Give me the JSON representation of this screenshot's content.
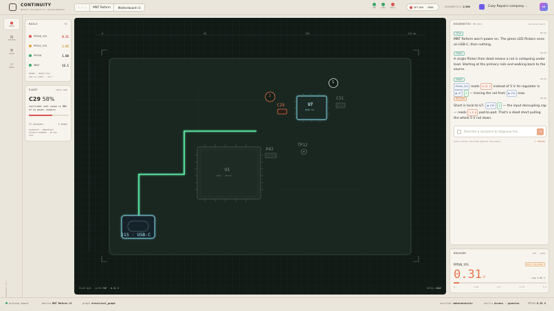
{
  "app": {
    "name": "CONTINUITY",
    "tagline": "BENCH DIAGNOSTIC ENVIRONMENT"
  },
  "toolbar": {
    "nav_arrows": "‹ › ⌄",
    "device": "MNT Reform",
    "board": "Motherboard r3"
  },
  "status": {
    "items": [
      {
        "label": "PWR",
        "color": "#3aa66a"
      },
      {
        "label": "LINK",
        "color": "#3aa66a"
      },
      {
        "label": "FAULT",
        "color": "#d9534f"
      }
    ],
    "session": "SPT-055 · GROG",
    "diag_label": "DIAGNOSTICS",
    "diag_count": "1/300",
    "workspace": "Cozy Repairs company",
    "avatar": "CR"
  },
  "sidebar": {
    "items": [
      {
        "label": "BENCH",
        "active": true
      },
      {
        "label": "SESSION"
      },
      {
        "label": "GRAPH"
      },
      {
        "label": "PARTS"
      }
    ],
    "version": "CONTINUITY V0.3"
  },
  "rails": {
    "title": "RAILS",
    "count": "05",
    "items": [
      {
        "name": "PP5V0_SYS",
        "value": "0.31",
        "color": "#d9534f",
        "value_color": "#c0392b"
      },
      {
        "name": "PP3V3_SYS",
        "value": "2.95",
        "color": "#e3a23c",
        "value_color": "#c98a24"
      },
      {
        "name": "PP5VB",
        "value": "1.80",
        "color": "#3aa66a",
        "value_color": "#2e2a24"
      },
      {
        "name": "VBAT",
        "value": "12.1",
        "color": "#3aa66a",
        "value_color": "#2e2a24"
      }
    ],
    "footer1": "PROBE · BENCH PSU",
    "footer2": "500 ms LIMIT · 25°C"
  },
  "fleet": {
    "title": "FLEET",
    "tag": "CROSS-SHOP",
    "headline_ref": "C29",
    "headline_pct": "58%",
    "desc1": "confirmed root cause in",
    "desc_bold": "58%",
    "desc2": "of no power repairs",
    "progress": 0.58,
    "stats_left": "12 sessions",
    "stats_right": "5 shops",
    "notes": [
      "AGGREGATE · ANONYMIZED",
      "SECURITY BOUNDED · NO RAW",
      "LOGS"
    ]
  },
  "board": {
    "ruler_top": [
      "0",
      "50",
      "100",
      "120 mm"
    ],
    "labels": {
      "u7": "U7",
      "u7sub": "BUCK 5V",
      "c29": "C29",
      "c31": "C31",
      "r42": "R42",
      "tp12": "TP12",
      "u1": "U1",
      "u1sub": "PMIC · BD718",
      "j15": "J15 · USB-C"
    },
    "markers": [
      "1",
      "2"
    ],
    "footer_left_label": "PLACE",
    "footer_left_val": "4/1",
    "footer_mid_label": "LAYER",
    "footer_mid_val": "TOP",
    "footer_mid2": "0.31 V",
    "footer_right_label": "DETAIL",
    "footer_right_val": "EDGE"
  },
  "diagnostic": {
    "title": "DIAGNOSTIC",
    "sub": "MR-2241",
    "status": "· pulsing board",
    "entries": [
      {
        "tag": "TECH",
        "time": "09:32",
        "text": "MNT Reform won't power on. The green LED flickers once on USB-C, then nothing."
      },
      {
        "tag": "TRACE",
        "time": "09:33",
        "text": "A single flicker then dead means a rail is collapsing under load. Starting at the primary rails and walking back to the source."
      },
      {
        "tag": "TRACE",
        "time": "09:33",
        "pre": "PP5V0_SYS",
        "mid": "reads",
        "val": "0.31 V",
        "post": "instead of 5 V. Its regulator is",
        "c1": "U7",
        "n1": "1",
        "post2": "— tracing the rail from",
        "c2": "J15",
        "post3": "now."
      },
      {
        "tag": "MEASURE",
        "time": "09:34",
        "p1": "Short is local to U7.",
        "c1": "C29",
        "n2": "2",
        "p2": "— the input decoupling cap — reads",
        "val": "3.9 Ω",
        "p3": "pad-to-pad. That's a dead short pulling the whole 5 V rail down."
      }
    ],
    "input_placeholder": "Describe a symptom to diagnose live...",
    "footer": "every action verified against the board",
    "footer_right": "replay"
  },
  "measure": {
    "title": "MEASURE",
    "tag": "DCV · AUTO",
    "net": "PP5V0_SYS",
    "badge": "RAIL COLLAPSE",
    "value": "0.31",
    "unit": "V",
    "exp": "exp 5.00 V",
    "scale": [
      "0",
      "1.25",
      "2.5",
      "3.75",
      "5 V"
    ],
    "fill": 0.062
  },
  "bottom": {
    "status": "pulsing board",
    "device_label": "device",
    "device": "MNT Reform r3",
    "graph_label": "graph",
    "graph": "electrical_graph",
    "verifier": "verifier",
    "verifier_val": "deterministic",
    "skills_label": "skills",
    "skills": "Access · pyvector",
    "probe_label": "PP5V0",
    "probe_val": "0.31 V"
  }
}
